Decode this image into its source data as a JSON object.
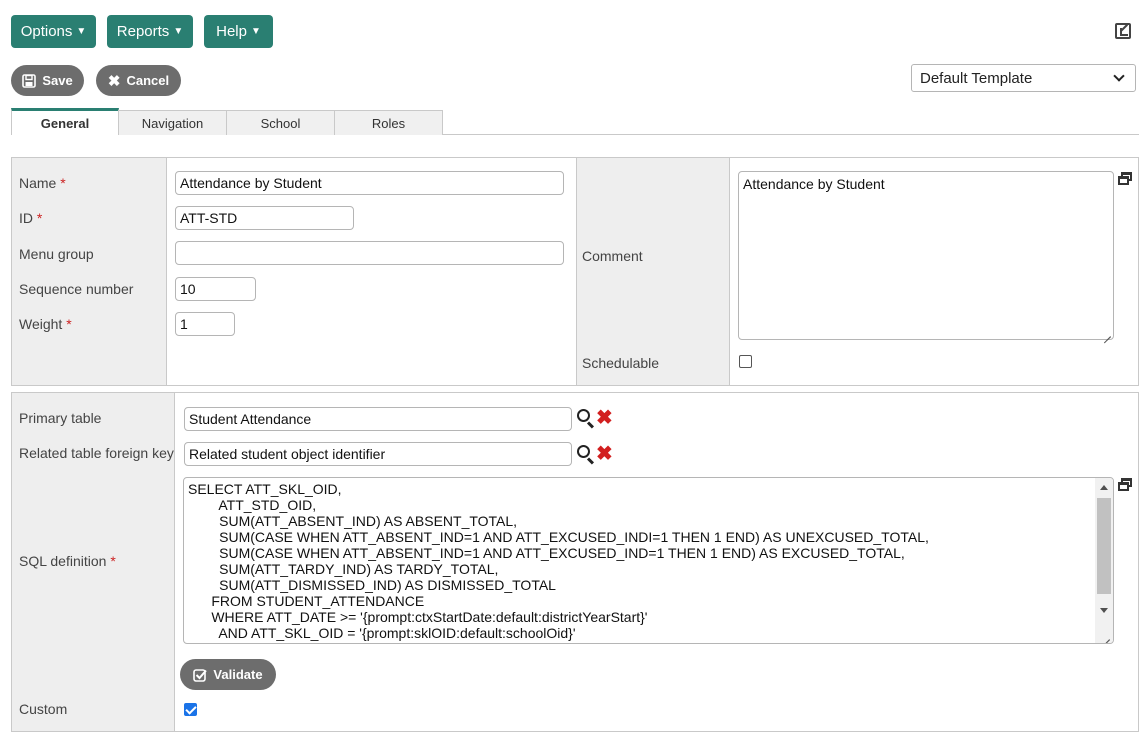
{
  "menu": {
    "options_label": "Options",
    "reports_label": "Reports",
    "help_label": "Help"
  },
  "actions": {
    "save_label": "Save",
    "cancel_label": "Cancel"
  },
  "template_select": {
    "value": "Default Template"
  },
  "tabs": [
    {
      "label": "General",
      "active": true
    },
    {
      "label": "Navigation",
      "active": false
    },
    {
      "label": "School",
      "active": false
    },
    {
      "label": "Roles",
      "active": false
    }
  ],
  "general": {
    "name_label": "Name",
    "name_value": "Attendance by Student",
    "id_label": "ID",
    "id_value": "ATT-STD",
    "menu_group_label": "Menu group",
    "menu_group_value": "",
    "sequence_label": "Sequence number",
    "sequence_value": "10",
    "weight_label": "Weight",
    "weight_value": "1",
    "comment_label": "Comment",
    "comment_value": "Attendance by Student",
    "schedulable_label": "Schedulable",
    "schedulable_checked": false,
    "required_mark": "*"
  },
  "query": {
    "primary_table_label": "Primary table",
    "primary_table_value": "Student Attendance",
    "related_fk_label": "Related table foreign key",
    "related_fk_value": "Related student object identifier",
    "sql_label": "SQL definition",
    "sql_value": "SELECT ATT_SKL_OID,\n        ATT_STD_OID,\n        SUM(ATT_ABSENT_IND) AS ABSENT_TOTAL,\n        SUM(CASE WHEN ATT_ABSENT_IND=1 AND ATT_EXCUSED_INDI=1 THEN 1 END) AS UNEXCUSED_TOTAL,\n        SUM(CASE WHEN ATT_ABSENT_IND=1 AND ATT_EXCUSED_IND=1 THEN 1 END) AS EXCUSED_TOTAL,\n        SUM(ATT_TARDY_IND) AS TARDY_TOTAL,\n        SUM(ATT_DISMISSED_IND) AS DISMISSED_TOTAL\n      FROM STUDENT_ATTENDANCE\n      WHERE ATT_DATE >= '{prompt:ctxStartDate:default:districtYearStart}'\n        AND ATT_SKL_OID = '{prompt:sklOID:default:schoolOid}'\n      GROUP BY ATT_SKL_OID, ATT_STD_OID",
    "validate_label": "Validate",
    "custom_label": "Custom",
    "custom_checked": true
  },
  "colors": {
    "accent": "#2a7f72",
    "pill": "#6d6d6d",
    "label_bg": "#eeeeee",
    "required": "#cc2222",
    "delete": "#d21f1f",
    "checkbox": "#1a73e8"
  },
  "icons": {
    "dropdown": "caret-down-icon",
    "popout": "popout-icon",
    "save": "floppy-disk-icon",
    "cancel": "close-icon",
    "expand": "expand-window-icon",
    "lookup": "search-icon",
    "clear": "delete-icon",
    "validate": "check-square-icon"
  }
}
